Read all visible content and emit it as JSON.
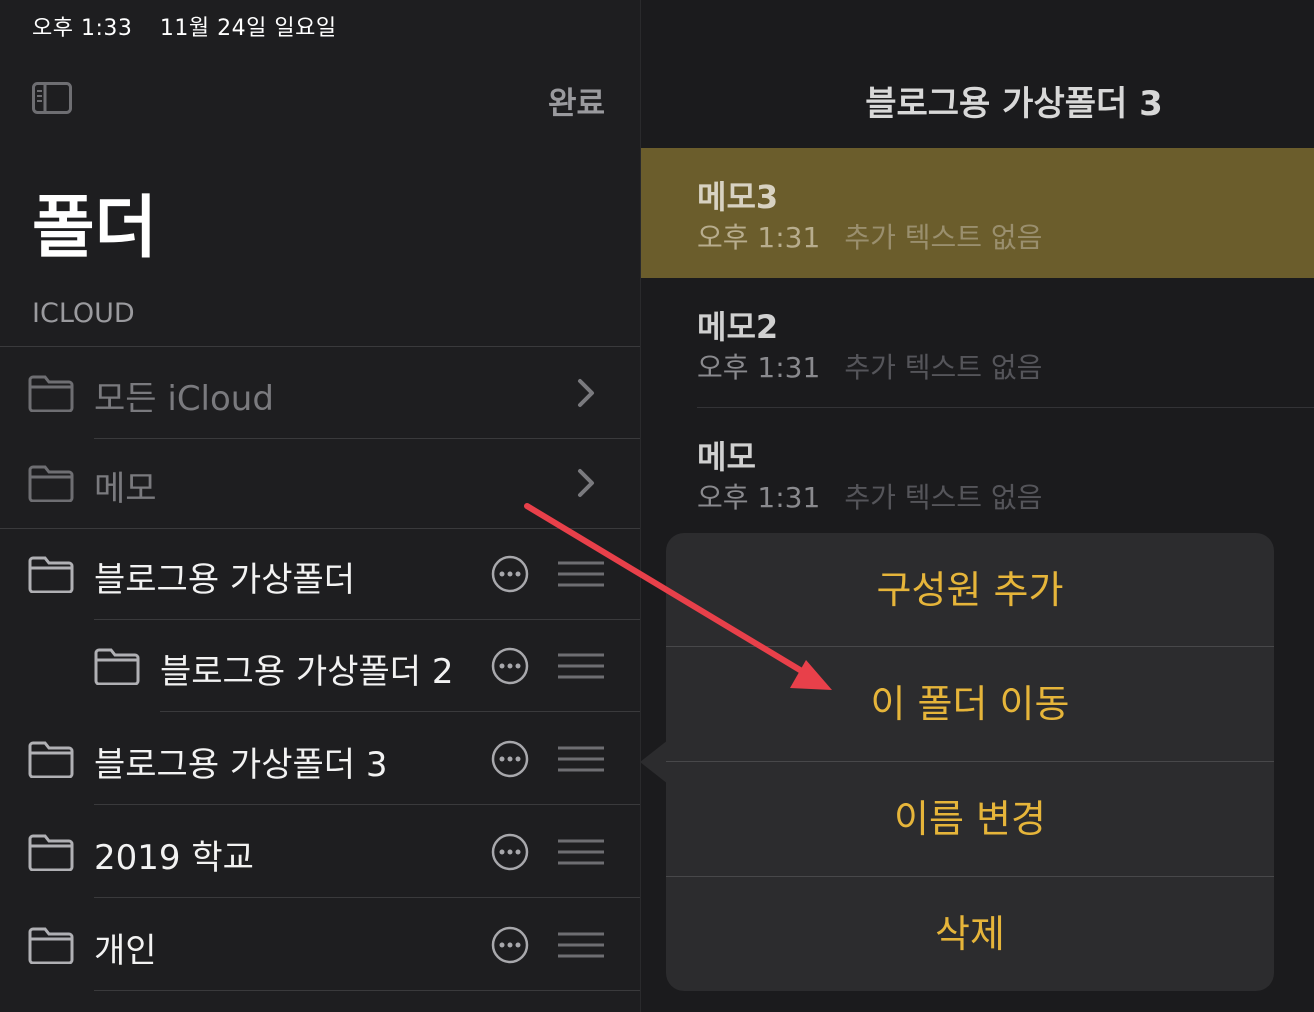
{
  "status_bar": {
    "time": "오후 1:33",
    "date": "11월 24일 일요일"
  },
  "sidebar": {
    "done_label": "완료",
    "title": "폴더",
    "section": "ICLOUD",
    "folders": [
      {
        "label": "모든 iCloud",
        "dim": true
      },
      {
        "label": "메모",
        "dim": true
      },
      {
        "label": "블로그용 가상폴더",
        "dim": false
      },
      {
        "label": "블로그용 가상폴더 2",
        "dim": false,
        "nested": true
      },
      {
        "label": "블로그용 가상폴더 3",
        "dim": false
      },
      {
        "label": "2019 학교",
        "dim": false
      },
      {
        "label": "개인",
        "dim": false
      }
    ]
  },
  "main": {
    "title": "블로그용 가상폴더 3",
    "notes": [
      {
        "title": "메모3",
        "time": "오후 1:31",
        "preview": "추가 텍스트 없음",
        "selected": true
      },
      {
        "title": "메모2",
        "time": "오후 1:31",
        "preview": "추가 텍스트 없음",
        "selected": false
      },
      {
        "title": "메모",
        "time": "오후 1:31",
        "preview": "추가 텍스트 없음",
        "selected": false
      }
    ]
  },
  "popover": {
    "items": [
      "구성원 추가",
      "이 폴더 이동",
      "이름 변경",
      "삭제"
    ]
  },
  "colors": {
    "accent": "#e6b53a",
    "selected_note": "#6b5d2c",
    "annotation_arrow": "#e8404a"
  }
}
